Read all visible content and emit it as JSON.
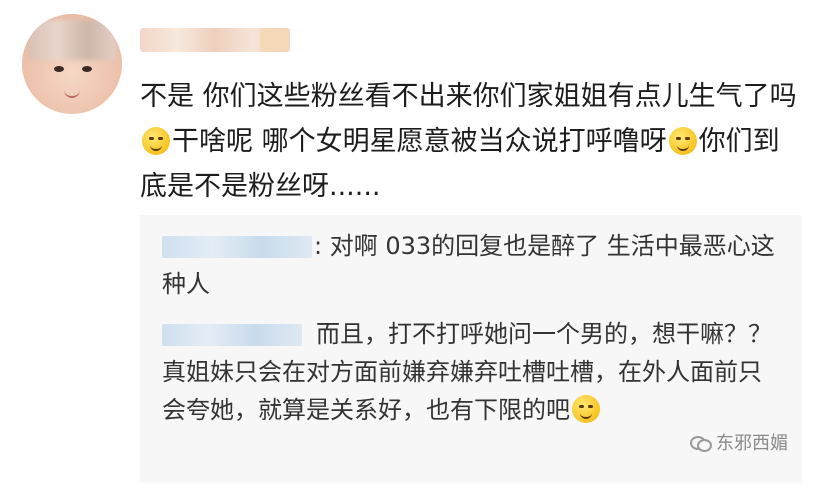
{
  "comment": {
    "text_part1": "不是 你们这些粉丝看不出来你们家姐姐有点儿生气了吗",
    "emoji1": "sweat-face-emoji",
    "text_part2": "干啥呢 哪个女明星愿意被当众说打呼噜呀",
    "emoji2": "grin-sweat-emoji",
    "text_part3": "你们到底是不是粉丝呀......"
  },
  "replies": [
    {
      "text": ": 对啊 033的回复也是醉了 生活中最恶心这种人"
    },
    {
      "text": "而且，打不打呼她问一个男的，想干嘛？？真姐妹只会在对方面前嫌弃嫌弃吐槽吐槽，在外人面前只会夸她，就算是关系好，也有下限的吧",
      "emoji": "grin-sweat-emoji"
    }
  ],
  "watermark": {
    "label": "东邪西媚",
    "icon": "wechat-icon"
  },
  "colors": {
    "reply_background": "#f7f7f7",
    "text": "#1c1c1c",
    "watermark": "#8a8a8a"
  }
}
